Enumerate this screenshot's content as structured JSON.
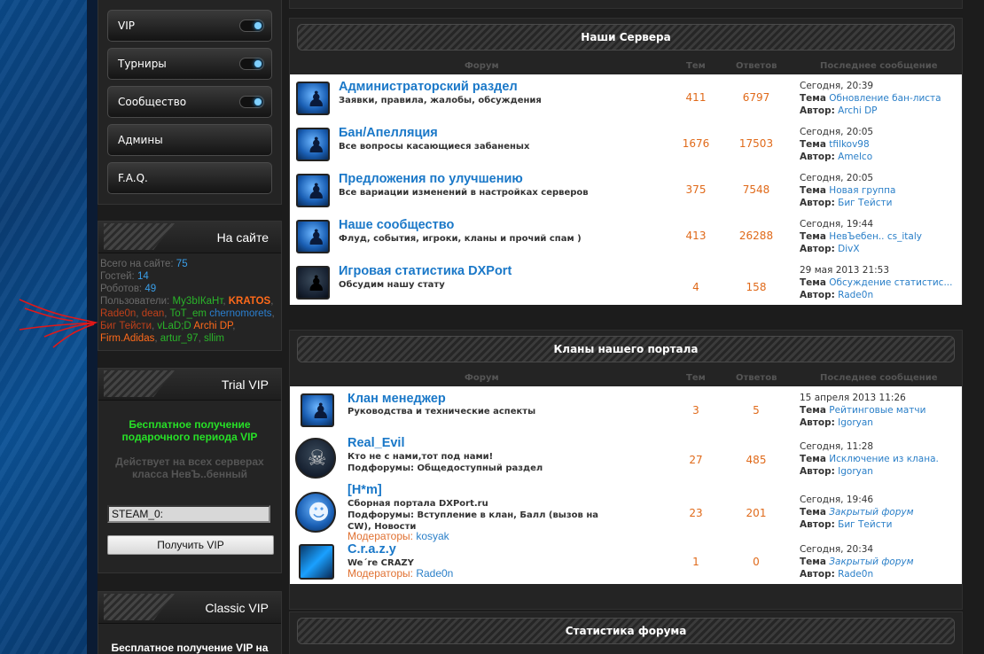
{
  "sidebar": {
    "menu": [
      {
        "label": "VIP",
        "toggle": true
      },
      {
        "label": "Турниры",
        "toggle": true
      },
      {
        "label": "Сообщество",
        "toggle": true
      },
      {
        "label": "Админы",
        "toggle": false
      },
      {
        "label": "F.A.Q.",
        "toggle": false
      }
    ],
    "online": {
      "title": "На сайте",
      "total_label": "Всего на сайте:",
      "total": "75",
      "guests_label": "Гостей:",
      "guests": "14",
      "robots_label": "Роботов:",
      "robots": "49",
      "users_label": "Пользователи:",
      "users": [
        {
          "name": "Му3bIКаНт",
          "color": "#2ab52a",
          "sep": ""
        },
        {
          "name": "KRATOS",
          "color": "#ff6a1a",
          "bold": true,
          "sep": ", "
        },
        {
          "name": "Rade0n",
          "color": "#c0401a",
          "sep": ", "
        },
        {
          "name": "dean",
          "color": "#c0401a",
          "sep": ", "
        },
        {
          "name": "ToT_em",
          "color": "#2ab52a",
          "sep": ", "
        },
        {
          "name": "chernomorets",
          "color": "#2a7fd0",
          "sep": ""
        },
        {
          "name": "Биг Тейсти",
          "color": "#c0401a",
          "sep": ", "
        },
        {
          "name": "vLaD;D",
          "color": "#2ab52a",
          "sep": ", "
        },
        {
          "name": "Archi DP",
          "color": "#ff6a1a",
          "sep": ""
        },
        {
          "name": "Firm.Adidas",
          "color": "#ff6a1a",
          "sep": ", "
        },
        {
          "name": "artur_97",
          "color": "#2ab52a",
          "sep": ", "
        },
        {
          "name": "sllim",
          "color": "#2ab52a",
          "sep": ", "
        }
      ]
    },
    "trial": {
      "title": "Trial VIP",
      "promo": "Бесплатное получение подарочного периода VIP",
      "note": "Действует на всех серверах класса НевЪ..бенный",
      "input_value": "STEAM_0:",
      "button_label": "Получить VIP"
    },
    "classic": {
      "title": "Classic VIP",
      "promo": "Бесплатное получение VIP на"
    }
  },
  "servers": {
    "title": "Наши Сервера",
    "columns": {
      "forum": "Форум",
      "topics": "Тем",
      "replies": "Ответов",
      "last": "Последнее сообщение"
    },
    "forums": [
      {
        "title": "Администраторский раздел",
        "desc": "Заявки, правила, жалобы, обсуждения",
        "topics": "411",
        "replies": "6797",
        "date": "Сегодня, 20:39",
        "topic_label": "Тема",
        "topic": "Обновление бан-листа",
        "author_label": "Автор:",
        "author": "Archi DP"
      },
      {
        "title": "Бан/Апелляция",
        "desc": "Все вопросы касающиеся забаненых",
        "topics": "1676",
        "replies": "17503",
        "date": "Сегодня, 20:05",
        "topic_label": "Тема",
        "topic": "tfilkov98",
        "author_label": "Автор:",
        "author": "Amelco"
      },
      {
        "title": "Предложения по улучшению",
        "desc": "Все вариации изменений в настройках серверов",
        "topics": "375",
        "replies": "7548",
        "date": "Сегодня, 20:05",
        "topic_label": "Тема",
        "topic": "Новая группа",
        "author_label": "Автор:",
        "author": "Биг Тейсти"
      },
      {
        "title": "Наше сообщество",
        "desc": "Флуд, события, игроки, кланы и прочий спам )",
        "topics": "413",
        "replies": "26288",
        "date": "Сегодня, 19:44",
        "topic_label": "Тема",
        "topic": "НевЪебен.. cs_italy",
        "author_label": "Автор:",
        "author": "DivX"
      },
      {
        "title": "Игровая статистика DXPort",
        "desc": "Обсудим нашу стату",
        "topics": "4",
        "replies": "158",
        "date": "29 мая 2013 21:53",
        "topic_label": "Тема",
        "topic": "Обсуждение статистис...",
        "author_label": "Автор:",
        "author": "Rade0n"
      }
    ]
  },
  "clans": {
    "title": "Кланы нашего портала",
    "columns": {
      "forum": "Форум",
      "topics": "Тем",
      "replies": "Ответов",
      "last": "Последнее сообщение"
    },
    "forums": [
      {
        "title": "Клан менеджер",
        "desc1": "Руководства и технические аспекты",
        "desc2": "",
        "desc3": "",
        "mod_label": "",
        "mod": "",
        "topics": "3",
        "replies": "5",
        "date": "15 апреля 2013 11:26",
        "topic_label": "Тема",
        "topic": "Рейтинговые матчи",
        "author_label": "Автор:",
        "author": "Igoryan"
      },
      {
        "title": "Real_Evil",
        "desc1": "Кто не с нами,тот под нами!",
        "desc2": "Подфорумы: Общедоступный раздел",
        "desc3": "",
        "mod_label": "",
        "mod": "",
        "topics": "27",
        "replies": "485",
        "date": "Сегодня, 11:28",
        "topic_label": "Тема",
        "topic": "Исключение из клана.",
        "author_label": "Автор:",
        "author": "Igoryan"
      },
      {
        "title": "[H*m]",
        "desc1": "Сборная портала DXPort.ru",
        "desc2": "Подфорумы: Вступление в клан, Балл (вызов на",
        "desc3": "CW), Новости",
        "mod_label": "Модераторы:",
        "mod": "kosyak",
        "topics": "23",
        "replies": "201",
        "date": "Сегодня, 19:46",
        "topic_label": "Тема",
        "topic": "Закрытый форум",
        "author_label": "Автор:",
        "author": "Биг Тейсти"
      },
      {
        "title": "C.r.a.z.y",
        "desc1": "We´re CRAZY",
        "desc2": "",
        "desc3": "",
        "mod_label": "Модераторы:",
        "mod": "Rade0n",
        "topics": "1",
        "replies": "0",
        "date": "Сегодня, 20:34",
        "topic_label": "Тема",
        "topic": "Закрытый форум",
        "author_label": "Автор:",
        "author": "Rade0n"
      }
    ]
  },
  "stats": {
    "title": "Статистика форума"
  },
  "colors": {
    "accent_blue": "#1a78c8",
    "count_orange": "#e06a1a",
    "promo_green": "#27e027"
  }
}
